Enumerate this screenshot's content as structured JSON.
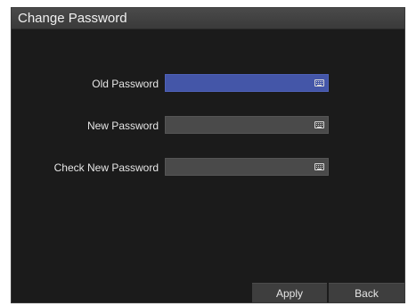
{
  "window": {
    "title": "Change Password"
  },
  "form": {
    "fields": [
      {
        "label": "Old Password",
        "value": "",
        "active": true,
        "icon": "keyboard-icon"
      },
      {
        "label": "New Password",
        "value": "",
        "active": false,
        "icon": "keyboard-icon"
      },
      {
        "label": "Check New Password",
        "value": "",
        "active": false,
        "icon": "keyboard-icon"
      }
    ]
  },
  "buttons": {
    "apply_label": "Apply",
    "back_label": "Back"
  },
  "colors": {
    "background": "#1b1b1b",
    "active_field": "#4456a8",
    "inactive_field": "#4a4a4a"
  }
}
